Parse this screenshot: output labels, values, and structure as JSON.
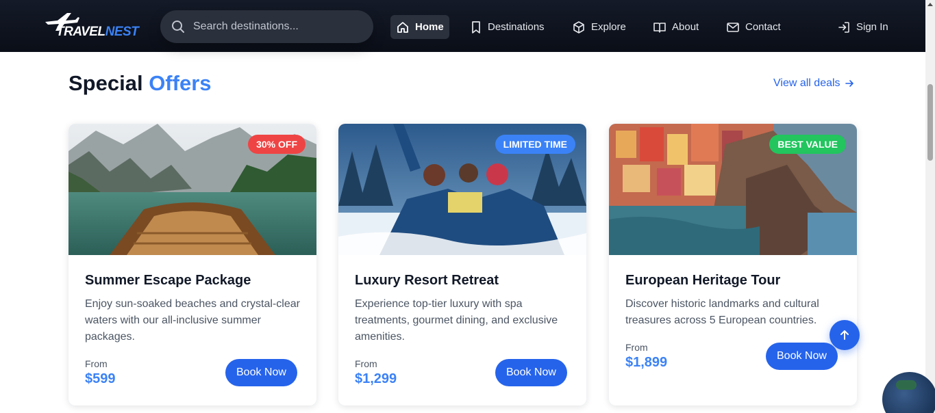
{
  "brand": {
    "name_part1": "TRAVEL",
    "name_part2": "NEST",
    "accent_color": "#3b82f6"
  },
  "search": {
    "placeholder": "Search destinations...",
    "value": ""
  },
  "nav": {
    "items": [
      {
        "label": "Home",
        "icon": "home-icon",
        "active": true
      },
      {
        "label": "Destinations",
        "icon": "bookmark-icon"
      },
      {
        "label": "Explore",
        "icon": "cube-icon"
      },
      {
        "label": "About",
        "icon": "book-icon"
      },
      {
        "label": "Contact",
        "icon": "mail-icon"
      }
    ],
    "sign_in": {
      "label": "Sign In",
      "icon": "sign-in-icon"
    }
  },
  "section": {
    "title_part1": "Special",
    "title_part2": "Offers",
    "view_all_label": "View all deals"
  },
  "cards": [
    {
      "badge": "30% OFF",
      "badge_color": "#ef4444",
      "title": "Summer Escape Package",
      "description": "Enjoy sun-soaked beaches and crystal-clear waters with our all-inclusive summer packages.",
      "from_label": "From",
      "price": "$599",
      "button_label": "Book Now",
      "image": "boat-on-mountain-lake"
    },
    {
      "badge": "LIMITED TIME",
      "badge_color": "#3b82f6",
      "title": "Luxury Resort Retreat",
      "description": "Experience top-tier luxury with spa treatments, gourmet dining, and exclusive amenities.",
      "from_label": "From",
      "price": "$1,299",
      "button_label": "Book Now",
      "image": "friends-in-snow"
    },
    {
      "badge": "BEST VALUE",
      "badge_color": "#22c55e",
      "title": "European Heritage Tour",
      "description": "Discover historic landmarks and cultural treasures across 5 European countries.",
      "from_label": "From",
      "price": "$1,899",
      "button_label": "Book Now",
      "image": "colorful-cliffside-village"
    }
  ],
  "scroll_to_top": {
    "icon": "arrow-up-icon"
  }
}
